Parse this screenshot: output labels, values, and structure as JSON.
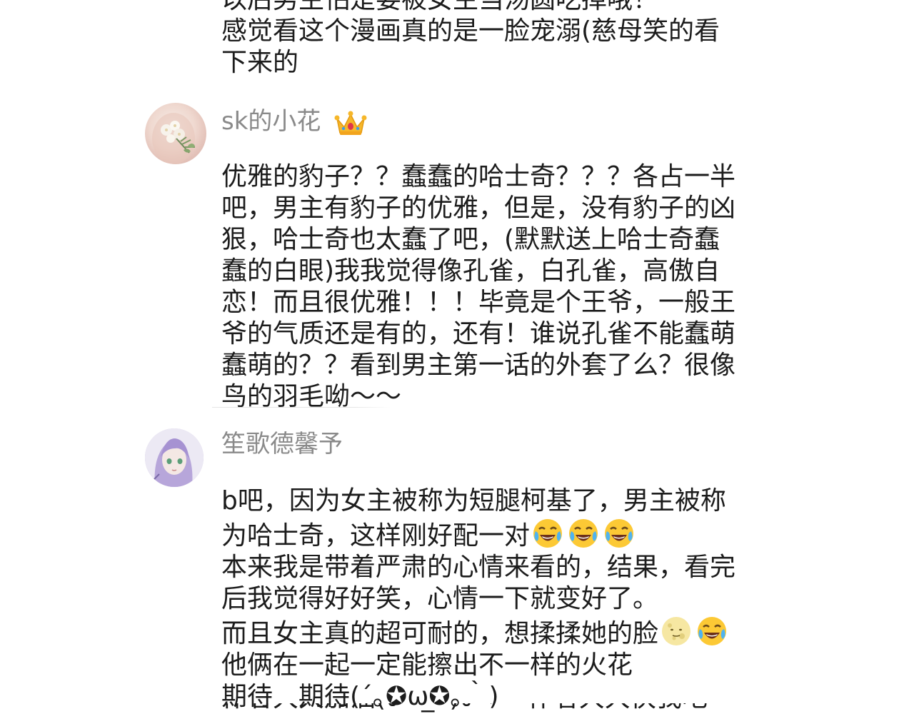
{
  "previous_comment": {
    "lines": [
      "以后男主怕是要被女主当汤圆吃掉哦！",
      "感觉看这个漫画真的是一脸宠溺(慈母笑的看",
      "下来的"
    ]
  },
  "comments": [
    {
      "username": "sk的小花",
      "badge_icon": "crown-icon",
      "lines": [
        "优雅的豹子？？蠢蠢的哈士奇？？？各占一半",
        "吧，男主有豹子的优雅，但是，没有豹子的凶",
        "狠，哈士奇也太蠢了吧，(默默送上哈士奇蠢",
        "蠢的白眼)我我觉得像孔雀，白孔雀，高傲自",
        "恋！而且很优雅！！！毕竟是个王爷，一般王",
        "爷的气质还是有的，还有！谁说孔雀不能蠢萌",
        "蠢萌的？？看到男主第一话的外套了么？很像",
        "鸟的羽毛呦～～"
      ]
    },
    {
      "username": "笙歌德馨予",
      "lines": [
        "b吧，因为女主被称为短腿柯基了，男主被称",
        "为哈士奇，这样刚好配一对",
        "本来我是带着严肃的心情来看的，结果，看完",
        "后我觉得好好笑，心情一下就变好了。",
        "而且女主真的超可耐的，想揉揉她的脸",
        "他俩在一起一定能擦出不一样的火花",
        "期待　期待(´｡✪ω✪｡｀)",
        "作者大大加油(ง •̀_•́)ง ❤「作者大大快我吧"
      ],
      "emoji_line_2": [
        "laughing-tears-icon",
        "laughing-tears-icon",
        "laughing-tears-icon"
      ],
      "emoji_line_5": [
        "moon-face-icon",
        "laughing-tears-icon"
      ]
    }
  ],
  "colors": {
    "text": "#1c1c1c",
    "username": "#8a8a8a",
    "background": "#ffffff"
  }
}
